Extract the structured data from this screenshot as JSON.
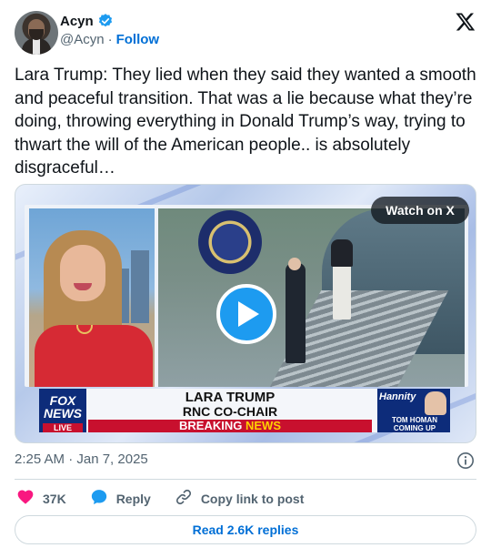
{
  "author": {
    "display_name": "Acyn",
    "handle": "@Acyn",
    "separator": "·",
    "follow_label": "Follow",
    "verified": true
  },
  "tweet": {
    "text": "Lara Trump: They lied when they said they wanted a smooth and peaceful transition. That was a lie because what they’re doing, throwing everything in Donald Trump’s way, trying to thwart the will of the American people.. is absolutely disgraceful…"
  },
  "media": {
    "watch_label": "Watch on X",
    "chyron": {
      "name": "LARA TRUMP",
      "role": "RNC CO-CHAIR",
      "banner_prefix": "BREAKING",
      "banner_suffix": "NEWS",
      "network_line1": "FOX",
      "network_line2": "NEWS",
      "network_tag": "LIVE",
      "promo_show": "Hannity",
      "promo_guest": "TOM HOMAN",
      "promo_status": "COMING UP"
    }
  },
  "meta": {
    "timestamp": "2:25 AM · Jan 7, 2025"
  },
  "actions": {
    "likes": "37K",
    "reply_label": "Reply",
    "copy_label": "Copy link to post"
  },
  "replies_button": "Read 2.6K replies",
  "colors": {
    "brand_blue": "#1d9bf0",
    "link_blue": "#006fd6",
    "heart_red": "#f91880",
    "muted_text": "#536471",
    "fox_red": "#c8102e",
    "fox_navy": "#0d2c7a"
  }
}
